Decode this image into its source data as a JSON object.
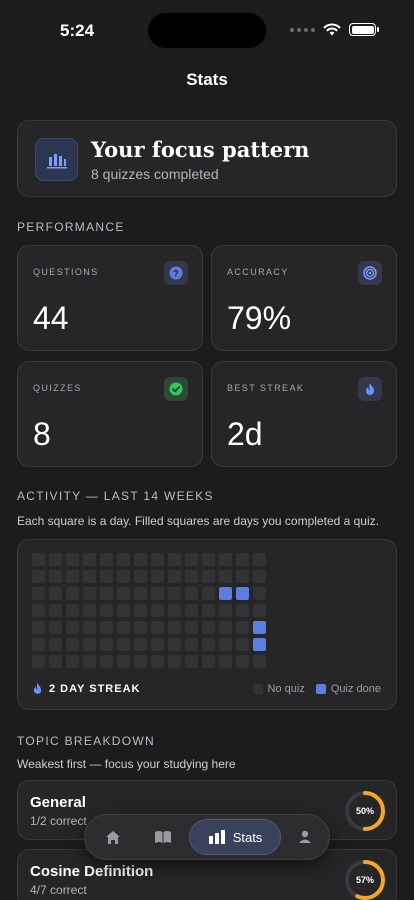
{
  "status": {
    "time": "5:24"
  },
  "nav": {
    "title": "Stats"
  },
  "hero": {
    "icon": "bar-chart-icon",
    "title": "Your focus pattern",
    "subtitle": "8 quizzes completed"
  },
  "performance": {
    "label": "PERFORMANCE",
    "questions": {
      "label": "QUESTIONS",
      "value": "44",
      "icon": "question-icon"
    },
    "accuracy": {
      "label": "ACCURACY",
      "value": "79%",
      "icon": "target-icon"
    },
    "quizzes": {
      "label": "QUIZZES",
      "value": "8",
      "icon": "check-icon"
    },
    "best_streak": {
      "label": "BEST STREAK",
      "value": "2d",
      "icon": "flame-icon"
    }
  },
  "activity": {
    "label": "ACTIVITY — LAST 14 WEEKS",
    "subtitle": "Each square is a day. Filled squares are days you completed a quiz.",
    "streak": "2 DAY STREAK",
    "legend_empty": "No quiz",
    "legend_done": "Quiz done",
    "filled_days": [
      [
        11,
        2
      ],
      [
        12,
        2
      ],
      [
        13,
        4
      ],
      [
        13,
        5
      ]
    ],
    "colors": {
      "empty": "#333336",
      "done": "#5b7ee0"
    }
  },
  "topics": {
    "label": "TOPIC BREAKDOWN",
    "subtitle": "Weakest first — focus your studying here",
    "items": [
      {
        "name": "General",
        "detail": "1/2 correct",
        "percent_label": "50%",
        "percent": 50
      },
      {
        "name": "Cosine Definition",
        "detail": "4/7 correct",
        "percent_label": "57%",
        "percent": 57
      }
    ]
  },
  "tabbar": {
    "active_label": "Stats",
    "tabs": [
      "home-icon",
      "book-icon",
      "stats-icon",
      "profile-icon"
    ]
  },
  "colors": {
    "accent": "#5b7ee0",
    "ring": "#f5a623",
    "background": "#1c1c1e"
  }
}
